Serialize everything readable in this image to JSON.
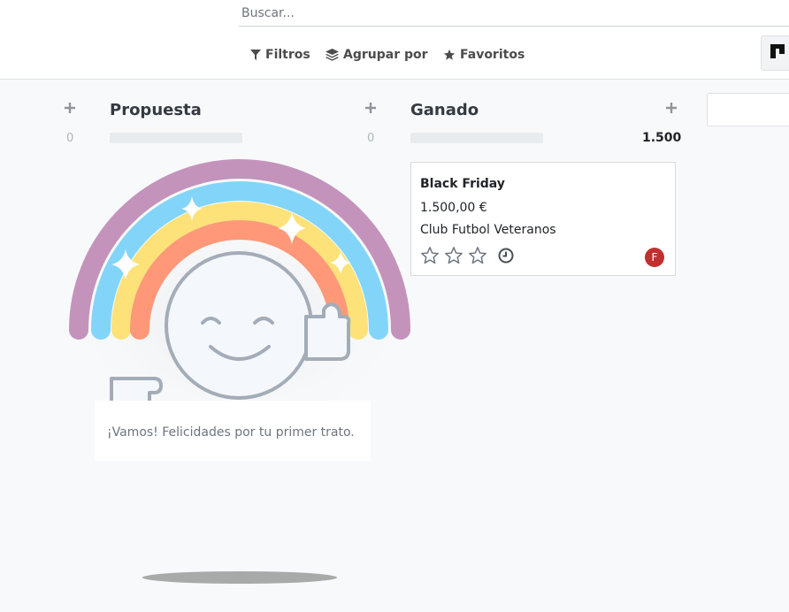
{
  "search": {
    "placeholder": "Buscar..."
  },
  "toolbar": {
    "filters_label": "Filtros",
    "group_by_label": "Agrupar por",
    "favorites_label": "Favoritos"
  },
  "columns": [
    {
      "count": "0"
    },
    {
      "title": "Propuesta",
      "count": "0"
    },
    {
      "title": "Ganado",
      "total": "1.500"
    }
  ],
  "card": {
    "title": "Black Friday",
    "amount": "1.500,00 €",
    "customer": "Club Futbol Veteranos",
    "avatar_initial": "F",
    "stars": 0
  },
  "help": {
    "message": "¡Vamos! Felicidades por tu primer trato."
  },
  "colors": {
    "rainbow": [
      "#c493bb",
      "#82d5f9",
      "#fde27a",
      "#fe9879"
    ],
    "avatar": "#c12f2f"
  }
}
